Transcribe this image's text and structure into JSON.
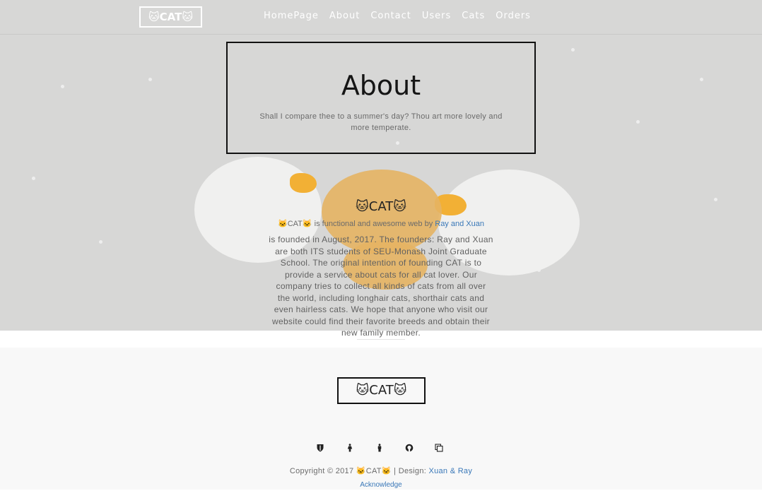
{
  "nav": {
    "logo": "🐱CAT🐱",
    "links": [
      "HomePage",
      "About",
      "Contact",
      "Users",
      "Cats",
      "Orders"
    ]
  },
  "about": {
    "title": "About",
    "subtitle": "Shall I compare thee to a summer's day? Thou art more lovely and more temperate."
  },
  "company": {
    "heading": "🐱CAT🐱",
    "tagline_brand": "🐱CAT🐱",
    "tagline_text": " is functional and awesome web by ",
    "tagline_link": "Ray and Xuan",
    "description": "is founded in August, 2017. The founders: Ray and Xuan are both ITS students of SEU-Monash Joint Graduate School. The original intention of founding CAT is to provide a service about cats for all cat lover. Our company tries to collect all kinds of cats from all over the world, including longhair cats, shorthair cats and even hairless cats. We hope that anyone who visit our website could find their favorite breeds and obtain their new family member."
  },
  "footer": {
    "logo": "🐱CAT🐱",
    "social_icons": [
      "shield-icon",
      "female-icon",
      "male-icon",
      "github-icon",
      "copy-icon"
    ],
    "copyright_text": "Copyright © 2017 🐱CAT🐱 | Design: ",
    "design_link": "Xuan & Ray",
    "acknowledge": "Acknowledge"
  },
  "colors": {
    "hero_bg": "#d7d7d6",
    "link": "#3a78b8",
    "footer_bg": "#f8f8f8"
  }
}
